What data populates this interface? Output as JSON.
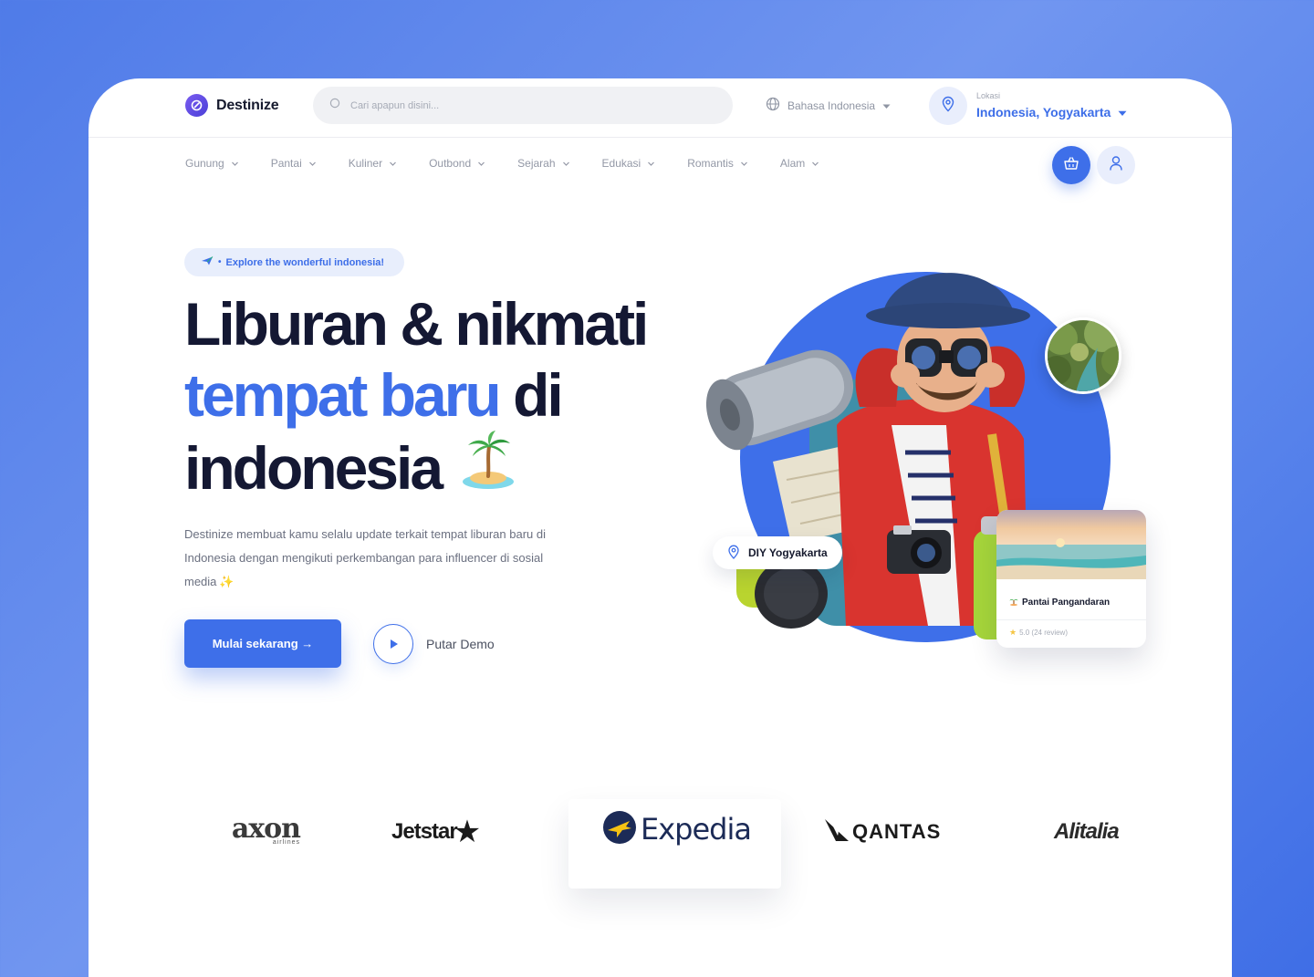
{
  "brand": {
    "name": "Destinize"
  },
  "search": {
    "placeholder": "Cari apapun disini..."
  },
  "language": {
    "label": "Bahasa Indonesia"
  },
  "location": {
    "label": "Lokasi",
    "value": "Indonesia, Yogyakarta"
  },
  "nav": {
    "items": [
      {
        "label": "Gunung"
      },
      {
        "label": "Pantai"
      },
      {
        "label": "Kuliner"
      },
      {
        "label": "Outbond"
      },
      {
        "label": "Sejarah"
      },
      {
        "label": "Edukasi"
      },
      {
        "label": "Romantis"
      },
      {
        "label": "Alam"
      }
    ]
  },
  "hero": {
    "badge": "Explore the wonderful indonesia!",
    "headline": {
      "line1": "Liburan & nikmati",
      "line2_blue": "tempat baru",
      "line2_rest": " di",
      "line3": "indonesia"
    },
    "description": "Destinize membuat kamu selalu update terkait tempat liburan baru di Indonesia dengan mengikuti perkembangan para influencer di sosial media",
    "cta_label": "Mulai sekarang →",
    "demo_label": "Putar Demo"
  },
  "location_chip": {
    "label": "DIY Yogyakarta"
  },
  "destination_card": {
    "title": "Pantai Pangandaran",
    "rating": "5.0 (24 review)"
  },
  "partners": [
    {
      "name": "axon",
      "sub": "airlines"
    },
    {
      "name": "Jetstar"
    },
    {
      "name": "Expedia"
    },
    {
      "name": "QANTAS"
    },
    {
      "name": "Alitalia"
    }
  ],
  "colors": {
    "primary": "#3e6fe9",
    "dark": "#141833",
    "background": "#5b86ec"
  }
}
